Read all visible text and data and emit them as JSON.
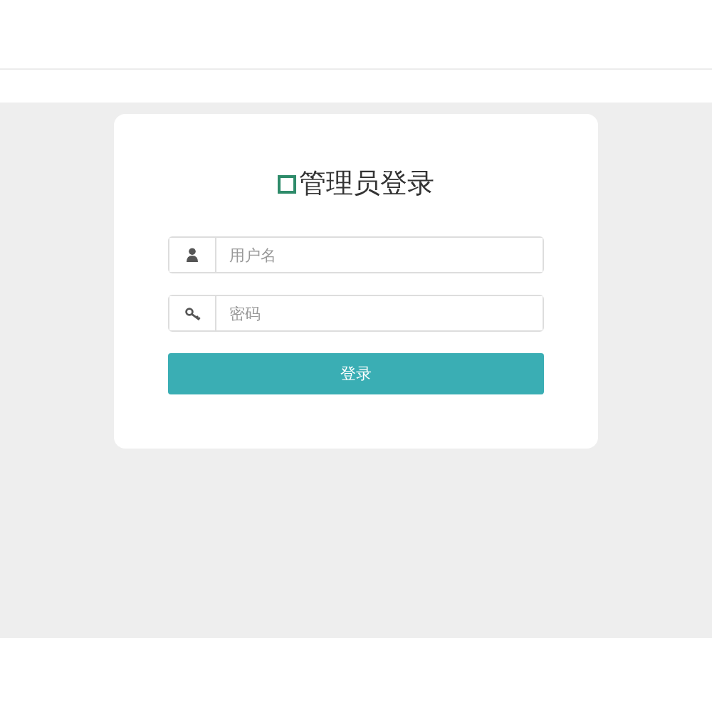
{
  "login": {
    "title": "管理员登录",
    "fields": [
      {
        "kind": "user",
        "placeholder": "用户名"
      },
      {
        "kind": "key",
        "placeholder": "密码"
      }
    ],
    "submit": "登录"
  }
}
